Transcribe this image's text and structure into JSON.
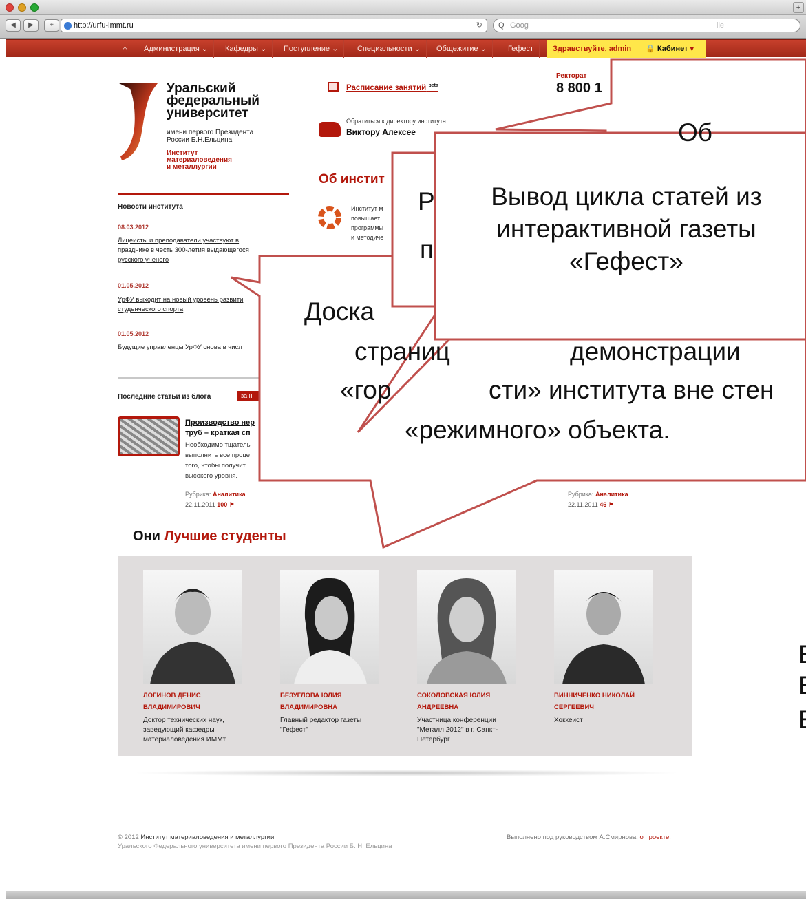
{
  "browser": {
    "url": "http://urfu-immt.ru",
    "search_placeholder": "Goog",
    "search_tail": "ile"
  },
  "nav": {
    "home_icon": "home-icon",
    "items": [
      "Администрация",
      "Кафедры",
      "Поступление",
      "Специальности",
      "Общежитие",
      "Гефест"
    ],
    "welcome": "Здравствуйте, admin",
    "cabinet": "Кабинет"
  },
  "logo": {
    "line1": "Уральский",
    "line2": "федеральный",
    "line3": "университет",
    "sub1": "имени первого Президента",
    "sub2": "России Б.Н.Ельцина",
    "inst1": "Институт",
    "inst2": "материаловедения",
    "inst3": "и металлургии"
  },
  "schedule": {
    "label": "Расписание занятий",
    "badge": "beta"
  },
  "director": {
    "label": "Обратиться к директору института",
    "name": "Виктору Алексее"
  },
  "rectorate": {
    "label": "Ректорат",
    "phone": "8 800 1"
  },
  "about": {
    "title": "Об инстит",
    "lines": [
      "Институт м",
      "повышает",
      "программы",
      "и методиче"
    ]
  },
  "news": {
    "heading": "Новости института",
    "items": [
      {
        "date": "08.03.2012",
        "text": [
          "Лицеисты и преподаватели участвуют в",
          "празднике в честь 300-летия выдающегося",
          "русского ученого"
        ]
      },
      {
        "date": "01.05.2012",
        "text": [
          "УрФУ выходит на новый уровень развити",
          "студенческого спорта"
        ]
      },
      {
        "date": "01.05.2012",
        "text": [
          "Будущие управленцы УрФУ снова в числ"
        ]
      }
    ]
  },
  "blog": {
    "heading": "Последние статьи из блога",
    "tag": "за н",
    "post": {
      "title": [
        "Производство нер",
        "труб – краткая сп"
      ],
      "text": [
        "Необходимо тщатель",
        "выполнить все проце",
        "того, чтобы получит",
        "высокого уровня."
      ],
      "rubric_label": "Рубрика:",
      "rubric": "Аналитика",
      "date": "22.11.2011",
      "count": "100"
    },
    "post2": {
      "rubric_label": "Рубрика:",
      "rubric": "Аналитика",
      "date": "22.11.2011",
      "count": "46"
    }
  },
  "students": {
    "heading_black": "Они",
    "heading_red": "Лучшие студенты",
    "items": [
      {
        "name1": "ЛОГИНОВ ДЕНИС",
        "name2": "ВЛАДИМИРОВИЧ",
        "desc": [
          "Доктор технических наук,",
          "заведующий кафедры",
          "материаловедения ИММт"
        ]
      },
      {
        "name1": "БЕЗУГЛОВА ЮЛИЯ",
        "name2": "ВЛАДИМИРОВНА",
        "desc": [
          "Главный редактор газеты",
          "\"Гефест\""
        ]
      },
      {
        "name1": "СОКОЛОВСКАЯ ЮЛИЯ",
        "name2": "АНДРЕЕВНА",
        "desc": [
          "Участница конференции",
          "\"Металл 2012\" в г. Санкт-",
          "Петербург"
        ]
      },
      {
        "name1": "ВИННИЧЕНКО НИКОЛАЙ",
        "name2": "СЕРГЕЕВИЧ",
        "desc": [
          "Хоккеист"
        ]
      }
    ]
  },
  "footer": {
    "copyright_prefix": "© 2012",
    "copyright": "Институт материаловедения и металлургии",
    "line2": "Уральского Федерального университета имени первого Президента России Б. Н. Ельцина",
    "made_by": "Выполнено под руководством А.Смирнова,",
    "about_link": "о проекте"
  },
  "callouts": {
    "front": [
      "Вывод цикла статей из",
      "интерактивной газеты",
      "«Гефест»"
    ],
    "middle_fragments": [
      "Р",
      "п"
    ],
    "back": [
      "Доска",
      "страниц",
      "демонстрации",
      "«гор",
      "сти» института вне стен",
      "«режимного» объекта."
    ],
    "top_right": "Об",
    "right_fragments": [
      "Е",
      "Е",
      "Е"
    ]
  },
  "colors": {
    "accent": "#b3180c",
    "nav": "#b8321f",
    "callout_border": "#c0504d",
    "welcome_bg": "#ffe74a"
  }
}
